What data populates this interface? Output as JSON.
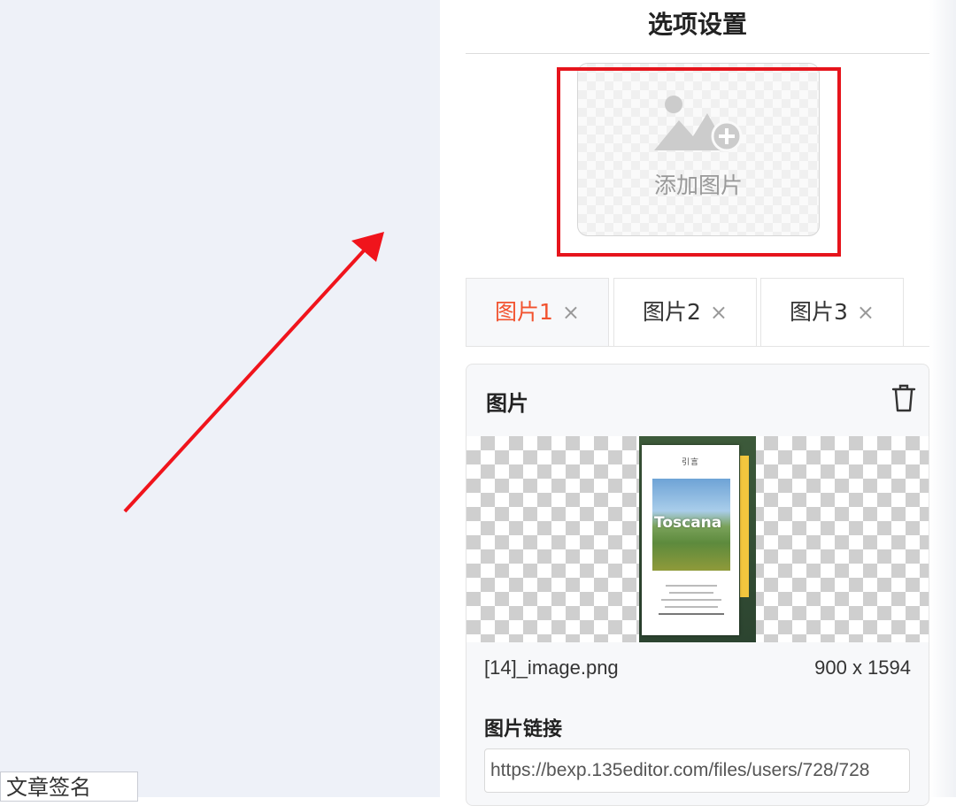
{
  "panel": {
    "title": "选项设置"
  },
  "upload": {
    "label": "添加图片",
    "icon": "add-image-icon"
  },
  "tabs": [
    {
      "label": "图片1",
      "close": "×",
      "active": true
    },
    {
      "label": "图片2",
      "close": "×",
      "active": false
    },
    {
      "label": "图片3",
      "close": "×",
      "active": false
    }
  ],
  "image_card": {
    "title": "图片",
    "delete_icon": "trash-icon",
    "preview": {
      "heading": "引言",
      "photo_text": "Toscana"
    },
    "file_name": "[14]_image.png",
    "dimensions": "900 x 1594",
    "link_label": "图片链接",
    "link_value": "https://bexp.135editor.com/files/users/728/728"
  },
  "editor": {
    "signature_tab": "文章签名"
  },
  "colors": {
    "highlight": "#e6141c",
    "arrow": "#f0141c",
    "active_tab": "#f2522e",
    "canvas": "#eef1f8"
  }
}
